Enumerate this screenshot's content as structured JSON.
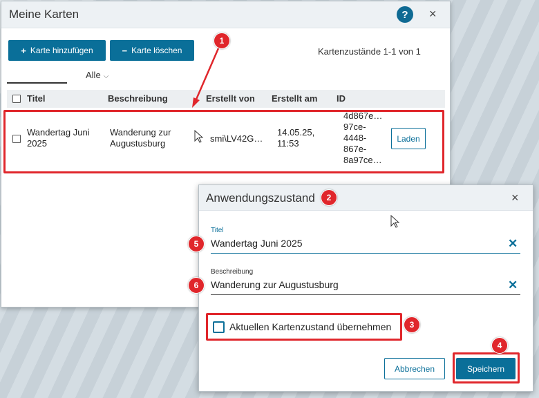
{
  "main_dialog": {
    "title": "Meine Karten",
    "help_label": "?",
    "close_label": "×",
    "add_button": {
      "icon": "+",
      "label": "Karte hinzufügen"
    },
    "delete_button": {
      "icon": "−",
      "label": "Karte löschen"
    },
    "count_text": "Kartenzustände 1-1 von 1",
    "filter": {
      "value": "Alle",
      "chevron": "⌵"
    },
    "columns": [
      "Titel",
      "Beschreibung",
      "Erstellt von",
      "Erstellt am",
      "ID"
    ],
    "rows": [
      {
        "title_lines": [
          "Wandertag Juni",
          "2025"
        ],
        "description_lines": [
          "Wanderung zur",
          "Augustusburg"
        ],
        "created_by": "smi\\LV42G…",
        "created_at_lines": [
          "14.05.25,",
          "11:53"
        ],
        "id_lines": [
          "4d867e…",
          "97ce-",
          "4448-",
          "867e-",
          "8a97ce…"
        ],
        "load_label": "Laden"
      }
    ]
  },
  "state_dialog": {
    "title": "Anwendungszustand",
    "close_label": "×",
    "title_field": {
      "label": "Titel",
      "value": "Wandertag Juni 2025"
    },
    "description_field": {
      "label": "Beschreibung",
      "value": "Wanderung zur Augustusburg"
    },
    "clear_label": "✕",
    "checkbox_label": "Aktuellen Kartenzustand übernehmen",
    "checkbox_checked": false,
    "cancel_label": "Abbrechen",
    "save_label": "Speichern"
  },
  "annotations": {
    "badges": [
      "1",
      "2",
      "3",
      "4",
      "5",
      "6"
    ],
    "color": "#e0262b"
  },
  "colors": {
    "primary": "#0a6f99",
    "highlight": "#e0262b",
    "header_bg": "#edf1f4"
  }
}
